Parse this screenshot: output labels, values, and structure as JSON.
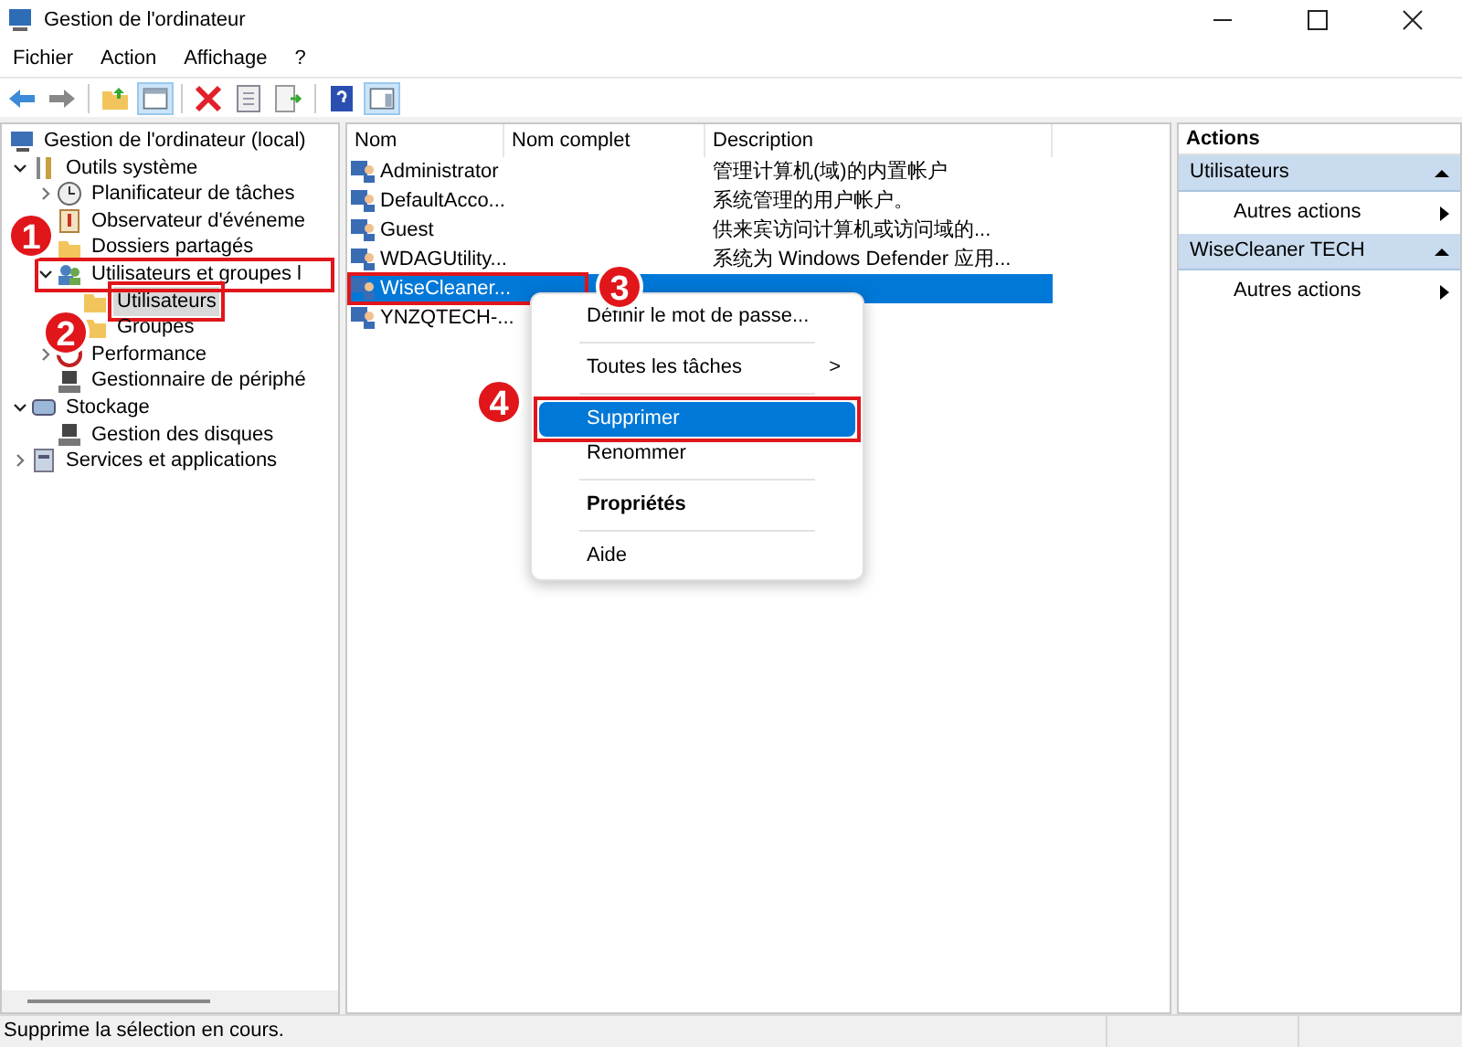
{
  "window": {
    "title": "Gestion de l'ordinateur"
  },
  "menu": [
    "Fichier",
    "Action",
    "Affichage",
    "?"
  ],
  "tree": [
    {
      "label": "Gestion de l'ordinateur (local)",
      "selected": false,
      "children": [
        {
          "label": "Outils système",
          "expanded": true,
          "selected": false,
          "children": [
            {
              "label": "Planificateur de tâches",
              "expanded": false,
              "selected": false
            },
            {
              "label": "Observateur d'événeme",
              "selected": false
            },
            {
              "label": "Dossiers partagés",
              "selected": false
            },
            {
              "label": "Utilisateurs et groupes l",
              "expanded": true,
              "selected": false,
              "callout": "1",
              "children": [
                {
                  "label": "Utilisateurs",
                  "selected": true,
                  "callout": "2"
                },
                {
                  "label": "Groupes",
                  "selected": false
                }
              ]
            },
            {
              "label": "Performance",
              "expanded": false,
              "selected": false
            },
            {
              "label": "Gestionnaire de périphé",
              "selected": false
            }
          ]
        },
        {
          "label": "Stockage",
          "expanded": true,
          "selected": false,
          "children": [
            {
              "label": "Gestion des disques",
              "selected": false
            }
          ]
        },
        {
          "label": "Services et applications",
          "expanded": false,
          "selected": false
        }
      ]
    }
  ],
  "table": {
    "columns": [
      "Nom",
      "Nom complet",
      "Description"
    ],
    "rows": [
      {
        "name": "Administrator",
        "description": "管理计算机(域)的内置帐户",
        "selected": false
      },
      {
        "name": "DefaultAcco...",
        "description": "系统管理的用户帐户。",
        "selected": false
      },
      {
        "name": "Guest",
        "description": "供来宾访问计算机或访问域的...",
        "selected": false
      },
      {
        "name": "WDAGUtility...",
        "description": "系统为 Windows Defender 应用...",
        "selected": false
      },
      {
        "name": "WiseCleaner...",
        "selected": true,
        "callout": "3"
      },
      {
        "name": "YNZQTECH-...",
        "selected": false
      }
    ]
  },
  "context_menu": [
    {
      "label": "Définir le mot de passe...",
      "kind": "item",
      "selected": false
    },
    {
      "kind": "separator"
    },
    {
      "label": "Toutes les tâches",
      "kind": "submenu",
      "selected": false
    },
    {
      "kind": "separator"
    },
    {
      "label": "Supprimer",
      "kind": "item",
      "selected": true,
      "callout": "4"
    },
    {
      "label": "Renommer",
      "kind": "item",
      "selected": false
    },
    {
      "kind": "separator"
    },
    {
      "label": "Propriétés",
      "kind": "default",
      "selected": false
    },
    {
      "kind": "separator"
    },
    {
      "label": "Aide",
      "kind": "item",
      "selected": false
    }
  ],
  "submenu_arrow": ">",
  "actions": {
    "title": "Actions",
    "sections": [
      {
        "title": "Utilisateurs",
        "items": [
          "Autres actions"
        ]
      },
      {
        "title": "WiseCleaner TECH",
        "items": [
          "Autres actions"
        ]
      }
    ]
  },
  "status_bar": "Supprime la sélection en cours."
}
